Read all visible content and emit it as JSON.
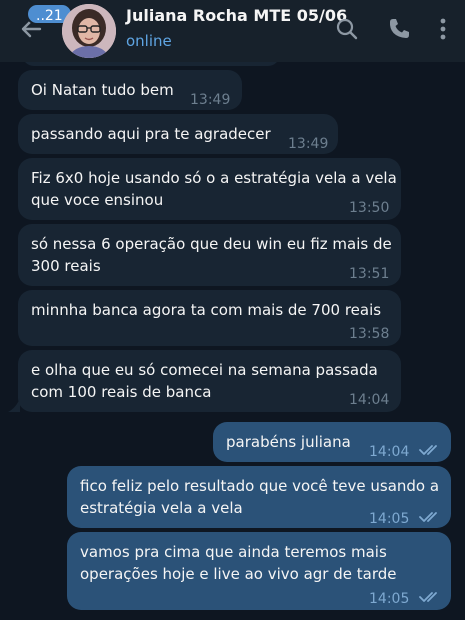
{
  "header": {
    "unread_count": "..21",
    "contact_name": "Juliana Rocha MTE 05/06",
    "status": "online"
  },
  "messages": [
    {
      "direction": "in",
      "lines": [
        "Oi Natan tudo bem"
      ],
      "time": "13:49"
    },
    {
      "direction": "in",
      "lines": [
        "passando aqui pra te agradecer"
      ],
      "time": "13:49"
    },
    {
      "direction": "in",
      "lines": [
        "Fiz 6x0 hoje usando só o a estratégia vela a vela",
        "que voce ensinou"
      ],
      "time": "13:50"
    },
    {
      "direction": "in",
      "lines": [
        "só nessa 6 operação que deu win eu fiz mais de",
        "300 reais"
      ],
      "time": "13:51"
    },
    {
      "direction": "in",
      "lines": [
        "minnha banca agora ta com mais de 700 reais"
      ],
      "time": "13:58"
    },
    {
      "direction": "in",
      "lines": [
        "e olha que eu só comecei na semana passada",
        "com 100 reais de banca"
      ],
      "time": "14:04"
    },
    {
      "direction": "out",
      "lines": [
        "parabéns juliana"
      ],
      "time": "14:04",
      "read": true
    },
    {
      "direction": "out",
      "lines": [
        "fico feliz pelo resultado que você teve usando a",
        "estratégia vela a vela"
      ],
      "time": "14:05",
      "read": true
    },
    {
      "direction": "out",
      "lines": [
        "vamos pra cima que ainda teremos mais",
        "operações hoje e live ao vivo agr de tarde"
      ],
      "time": "14:05",
      "read": true
    }
  ],
  "colors": {
    "background": "#0e1621",
    "header": "#17212b",
    "incoming_bubble": "#182533",
    "outgoing_bubble": "#2b5278",
    "accent": "#5fa5e3",
    "badge": "#4e8ed1"
  },
  "icons": [
    "back-arrow-icon",
    "search-icon",
    "phone-icon",
    "more-vertical-icon",
    "double-check-icon"
  ]
}
